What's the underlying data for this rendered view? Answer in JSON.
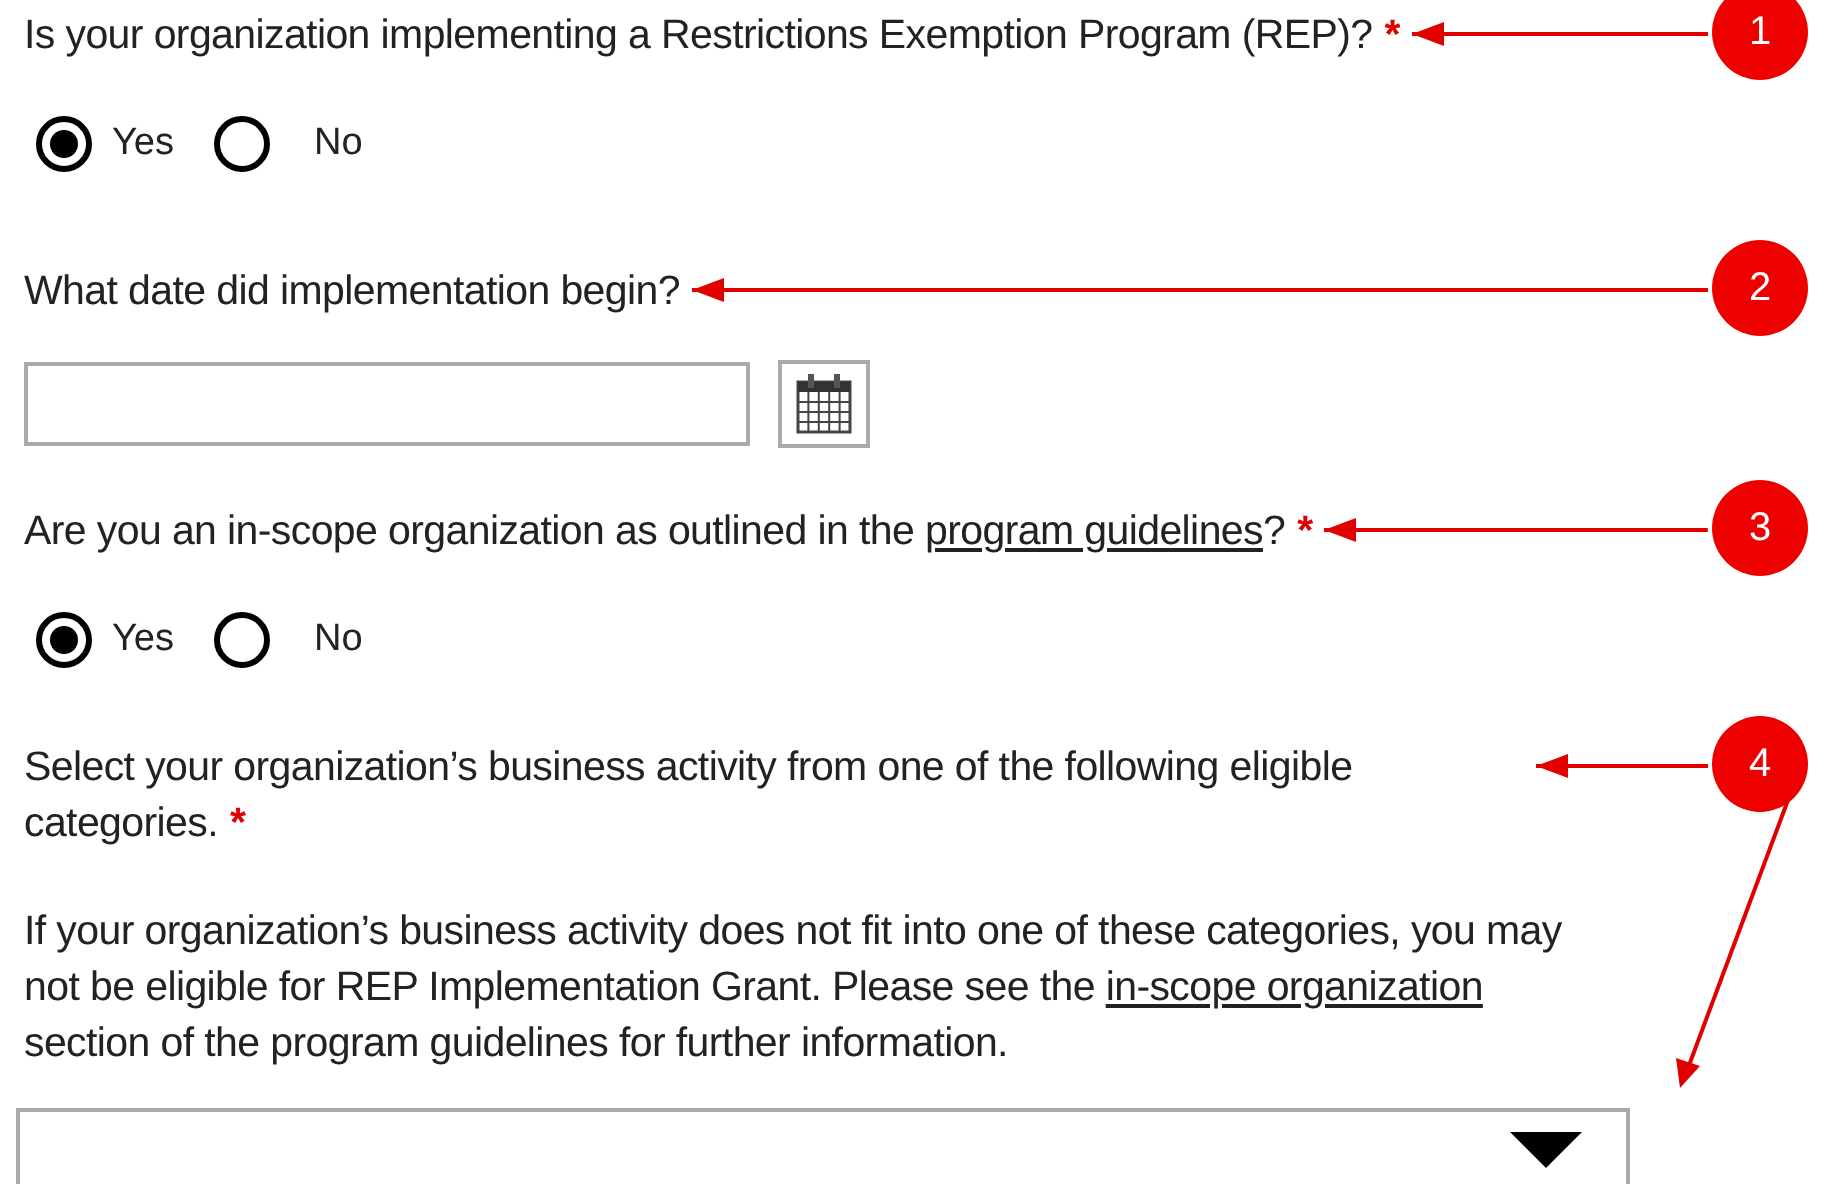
{
  "questions": [
    {
      "kind": "radio",
      "label": [
        {
          "text": "Is your organization implementing  a Restrictions Exemption  Program (REP)?"
        }
      ],
      "required_mark": "*",
      "callout": "1",
      "options": [
        {
          "label": "Yes",
          "selected": true
        },
        {
          "label": "No",
          "selected": false
        }
      ]
    },
    {
      "kind": "date",
      "label": [
        {
          "text": "What date did implementation  begin?"
        }
      ],
      "callout": "2"
    },
    {
      "kind": "radio",
      "label": [
        {
          "text": "Are you an in-scope organization as outlined  in the "
        },
        {
          "text": "program guidelines",
          "link": true
        },
        {
          "text": "?"
        }
      ],
      "required_mark": "*",
      "callout": "3",
      "options": [
        {
          "label": "Yes",
          "selected": true
        },
        {
          "label": "No",
          "selected": false
        }
      ]
    },
    {
      "kind": "select",
      "label": [
        {
          "text": "Select your organization’s business activity from one of the following eligible categories."
        }
      ],
      "required_mark": "*",
      "callout": "4",
      "note": [
        {
          "text": "If your organization’s business activity does not fit into one of these categories, you may not be eligible  for REP Implementation Grant. Please see the "
        },
        {
          "text": "in-scope organization",
          "link": true
        },
        {
          "text": " section of the program guidelines for further information."
        }
      ]
    }
  ]
}
